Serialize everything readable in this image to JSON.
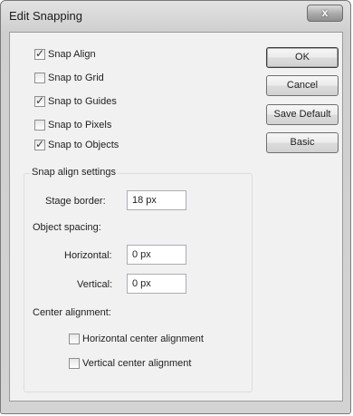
{
  "window": {
    "title": "Edit Snapping",
    "close_label": "x"
  },
  "snap_options": [
    {
      "label": "Snap Align",
      "checked": true
    },
    {
      "label": "Snap to Grid",
      "checked": false
    },
    {
      "label": "Snap to Guides",
      "checked": true
    },
    {
      "label": "Snap to Pixels",
      "checked": false
    },
    {
      "label": "Snap to Objects",
      "checked": true
    }
  ],
  "buttons": {
    "ok": "OK",
    "cancel": "Cancel",
    "save_default": "Save Default",
    "basic": "Basic"
  },
  "snap_align_settings": {
    "group_label": "Snap align settings",
    "stage_border_label": "Stage border:",
    "stage_border_value": "18 px",
    "object_spacing_label": "Object spacing:",
    "horizontal_label": "Horizontal:",
    "horizontal_value": "0 px",
    "vertical_label": "Vertical:",
    "vertical_value": "0 px",
    "center_alignment_label": "Center alignment:",
    "horizontal_center_label": "Horizontal center alignment",
    "horizontal_center_checked": false,
    "vertical_center_label": "Vertical center alignment",
    "vertical_center_checked": false
  }
}
